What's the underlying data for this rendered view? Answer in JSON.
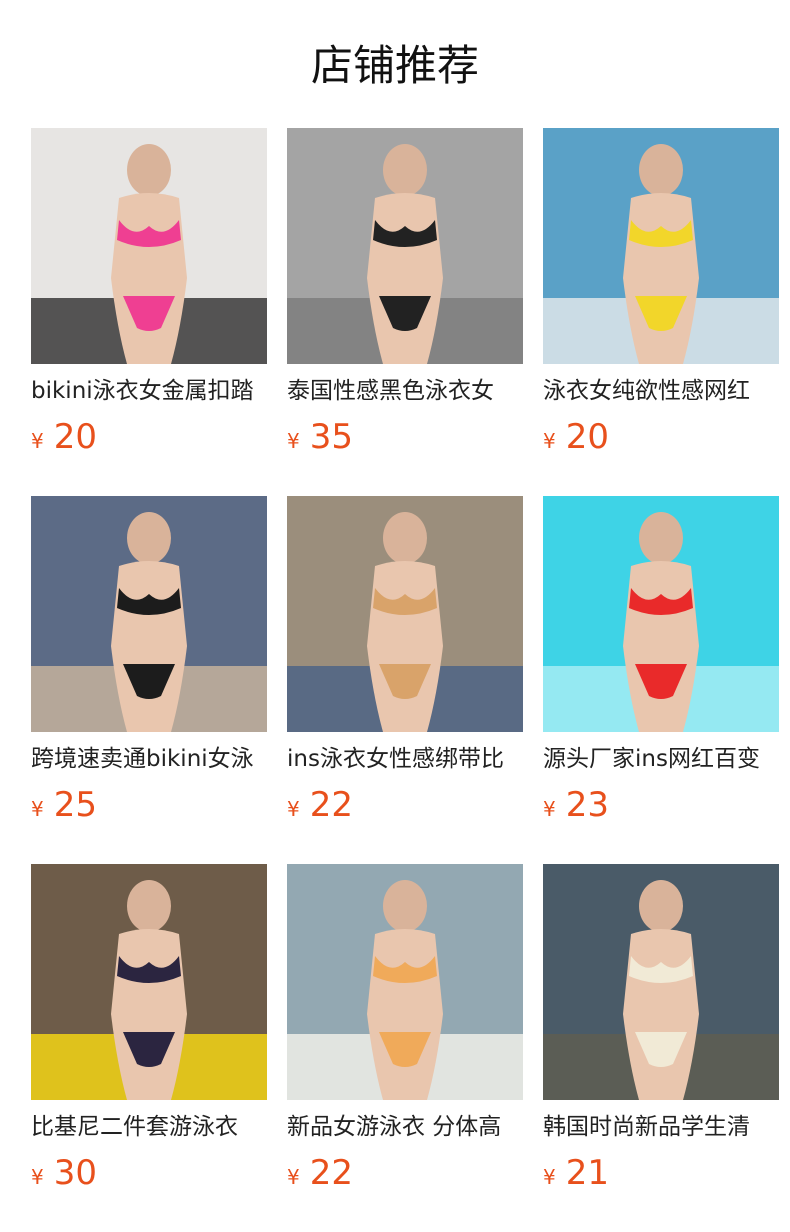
{
  "section": {
    "title": "店铺推荐"
  },
  "currency_symbol": "¥",
  "products": [
    {
      "name": "bikini泳衣女金属扣踏",
      "price": "20",
      "colors": {
        "bg": "#e7e5e3",
        "accent": "#ef3f92",
        "floor": "#3a3a3a"
      }
    },
    {
      "name": "泰国性感黑色泳衣女",
      "price": "35",
      "colors": {
        "bg": "#a4a4a4",
        "accent": "#222222",
        "floor": "#7e7e7e"
      }
    },
    {
      "name": "泳衣女纯欲性感网红",
      "price": "20",
      "colors": {
        "bg": "#5aa1c7",
        "accent": "#f2d62a",
        "floor": "#dfe6ea"
      }
    },
    {
      "name": "跨境速卖通bikini女泳",
      "price": "25",
      "colors": {
        "bg": "#5c6b86",
        "accent": "#1c1c1c",
        "floor": "#c4b29c"
      }
    },
    {
      "name": "ins泳衣女性感绑带比",
      "price": "22",
      "colors": {
        "bg": "#9b8e7c",
        "accent": "#d9a36a",
        "floor": "#4e6486"
      }
    },
    {
      "name": "源头厂家ins网红百变",
      "price": "23",
      "colors": {
        "bg": "#3ed3e6",
        "accent": "#e92a2a",
        "floor": "#a5ecf3"
      }
    },
    {
      "name": "比基尼二件套游泳衣",
      "price": "30",
      "colors": {
        "bg": "#6e5c49",
        "accent": "#2b2540",
        "floor": "#f3d414"
      }
    },
    {
      "name": "新品女游泳衣 分体高",
      "price": "22",
      "colors": {
        "bg": "#93a8b2",
        "accent": "#f0aa5a",
        "floor": "#efefe7"
      }
    },
    {
      "name": "韩国时尚新品学生清",
      "price": "21",
      "colors": {
        "bg": "#4a5b68",
        "accent": "#f1ead6",
        "floor": "#5e5e52"
      }
    }
  ]
}
